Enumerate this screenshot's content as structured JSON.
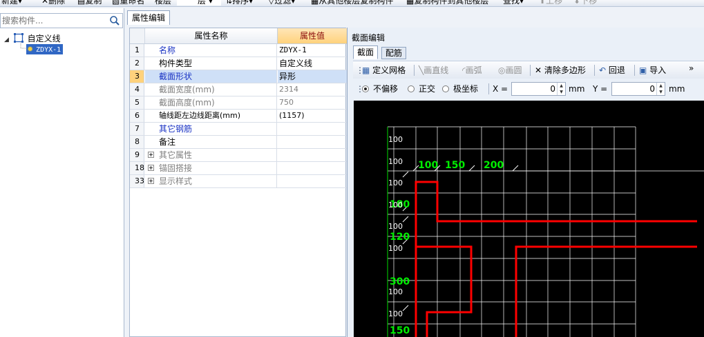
{
  "toolbar": {
    "new_label": "新建",
    "delete_label": "删除",
    "copy_label": "复制",
    "rename_label": "重命名",
    "floor_label": "楼层",
    "floor_value": "层",
    "sort_label": "排序",
    "filter_label": "过滤",
    "copy_from_label": "从其他楼层复制构件",
    "copy_to_label": "复制构件到其他楼层",
    "find_label": "查找",
    "move_up_label": "上移",
    "move_down_label": "下移"
  },
  "left_panel": {
    "search_placeholder": "搜索构件...",
    "tree": {
      "root_label": "自定义线",
      "child_label": "ZDYX-1"
    }
  },
  "main": {
    "tab_label": "属性编辑",
    "grid": {
      "header_name": "属性名称",
      "header_value": "属性值",
      "rows": [
        {
          "num": "1",
          "name": "名称",
          "value": "ZDYX-1"
        },
        {
          "num": "2",
          "name": "构件类型",
          "value": "自定义线"
        },
        {
          "num": "3",
          "name": "截面形状",
          "value": "异形"
        },
        {
          "num": "4",
          "name": "截面宽度(mm)",
          "value": "2314"
        },
        {
          "num": "5",
          "name": "截面高度(mm)",
          "value": "750"
        },
        {
          "num": "6",
          "name": "轴线距左边线距离(mm)",
          "value": "(1157)"
        },
        {
          "num": "7",
          "name": "其它钢筋",
          "value": ""
        },
        {
          "num": "8",
          "name": "备注",
          "value": ""
        },
        {
          "num": "9",
          "name": "其它属性",
          "value": ""
        },
        {
          "num": "18",
          "name": "锚固搭接",
          "value": ""
        },
        {
          "num": "33",
          "name": "显示样式",
          "value": ""
        }
      ]
    }
  },
  "editor": {
    "title": "截面编辑",
    "tabs": [
      "截面",
      "配筋"
    ],
    "toolbar": {
      "define_grid": "定义网格",
      "draw_line": "画直线",
      "draw_arc": "画弧",
      "draw_circle": "画圆",
      "clear_polygon": "清除多边形",
      "undo": "回退",
      "import": "导入",
      "more": "»"
    },
    "coords": {
      "no_offset": "不偏移",
      "orthogonal": "正交",
      "polar": "极坐标",
      "x_label": "X =",
      "x_value": "0",
      "x_unit": "mm",
      "y_label": "Y =",
      "y_value": "0",
      "y_unit": "mm"
    },
    "canvas": {
      "grid_color": "#ffffff",
      "shape_color": "#ff0000",
      "dim_color": "#00ff00",
      "top_dims": [
        "100",
        "150",
        "200"
      ],
      "left_grid_labels": [
        "100",
        "100",
        "100",
        "100",
        "100",
        "100",
        "100",
        "100"
      ],
      "left_dims": [
        "180",
        "120",
        "300",
        "150"
      ]
    }
  }
}
